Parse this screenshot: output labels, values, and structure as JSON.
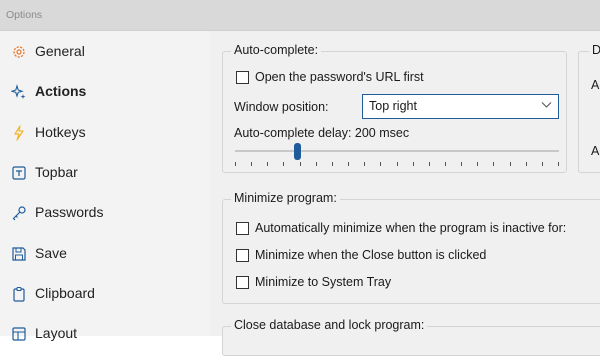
{
  "window": {
    "title": "Options"
  },
  "sidebar": {
    "items": [
      {
        "label": "General",
        "icon": "gear-icon",
        "active": false
      },
      {
        "label": "Actions",
        "icon": "sparkle-icon",
        "active": true
      },
      {
        "label": "Hotkeys",
        "icon": "lightning-icon",
        "active": false
      },
      {
        "label": "Topbar",
        "icon": "topbar-icon",
        "active": false
      },
      {
        "label": "Passwords",
        "icon": "key-icon",
        "active": false
      },
      {
        "label": "Save",
        "icon": "floppy-icon",
        "active": false
      },
      {
        "label": "Clipboard",
        "icon": "clipboard-icon",
        "active": false
      },
      {
        "label": "Layout",
        "icon": "layout-icon",
        "active": false
      }
    ]
  },
  "autocomplete": {
    "legend": "Auto-complete:",
    "open_url_label": "Open the password's URL first",
    "open_url_checked": false,
    "window_position_label": "Window position:",
    "window_position_value": "Top right",
    "delay_label": "Auto-complete delay: 200 msec",
    "delay_slider_fraction": 0.19
  },
  "right_group": {
    "legend": "D",
    "line1": "Ac",
    "line2": "Ac"
  },
  "minimize": {
    "legend": "Minimize program:",
    "items": [
      {
        "label": "Automatically minimize when the program is inactive for:",
        "checked": false
      },
      {
        "label": "Minimize when the Close button is clicked",
        "checked": false
      },
      {
        "label": "Minimize to System Tray",
        "checked": false
      }
    ]
  },
  "close_db": {
    "legend": "Close database and lock program:"
  },
  "colors": {
    "accent": "#1f5c99",
    "icon_orange": "#e8792b",
    "icon_gold": "#f3b52b",
    "icon_blue": "#1f5c99"
  }
}
